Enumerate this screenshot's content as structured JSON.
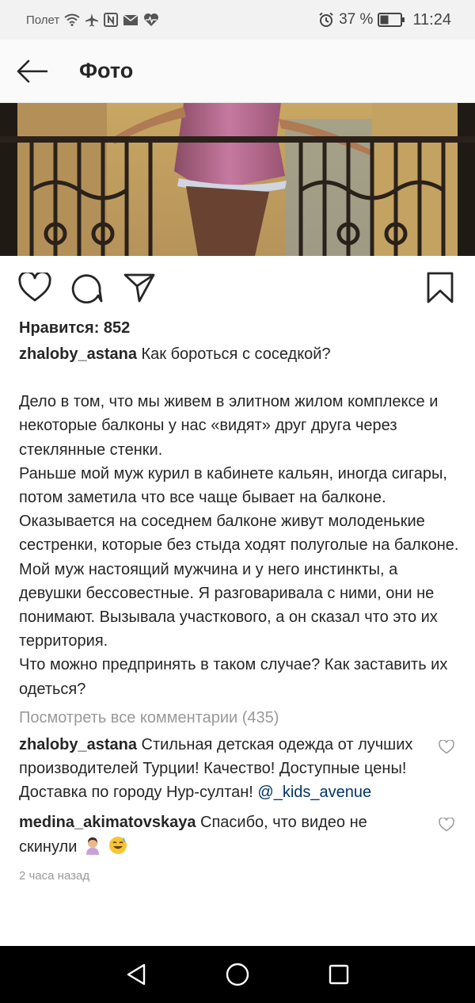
{
  "status_bar": {
    "carrier": "Полет",
    "battery_percent": "37 %",
    "time": "11:24",
    "icons": [
      "wifi-icon",
      "airplane-icon",
      "nfc-icon",
      "mail-icon",
      "heart-pulse-icon",
      "alarm-icon",
      "battery-icon"
    ]
  },
  "header": {
    "title": "Фото"
  },
  "post": {
    "likes_label": "Нравится: 852",
    "author": "zhaloby_astana",
    "caption_title": "Как бороться с соседкой?",
    "caption_p1": "Дело в том, что мы живем в элитном жилом комплексе и некоторые балконы у нас «видят» друг друга через стеклянные стенки.",
    "caption_p2": "Раньше мой муж курил в кабинете кальян, иногда сигары, потом заметила что все чаще бывает на балконе. Оказывается на соседнем балконе живут молоденькие сестренки, которые без стыда ходят полуголые на балконе. Мой муж настоящий мужчина и у него инстинкты, а девушки бессовестные. Я разговаривала с ними, они не понимают. Вызывала участкового, а он сказал что это их территория.",
    "caption_p3": "Что можно предпринять в таком случае? Как заставить их одеться?",
    "view_all_comments": "Посмотреть все комментарии (435)",
    "comments": [
      {
        "user": "zhaloby_astana",
        "text": "Стильная детская одежда от лучших производителей Турции!  Качество! Доступные цены! Доставка по городу Нур-султан!",
        "mention": "@_kids_avenue"
      },
      {
        "user": "medina_akimatovskaya",
        "text": "Спасибо, что видео не скинули"
      }
    ],
    "timestamp": "2 часа назад"
  },
  "colors": {
    "text": "#262626",
    "muted": "#999999",
    "mention": "#003569",
    "status_bar_bg": "#f2f2f2",
    "nav_bar_bg": "#000000"
  }
}
